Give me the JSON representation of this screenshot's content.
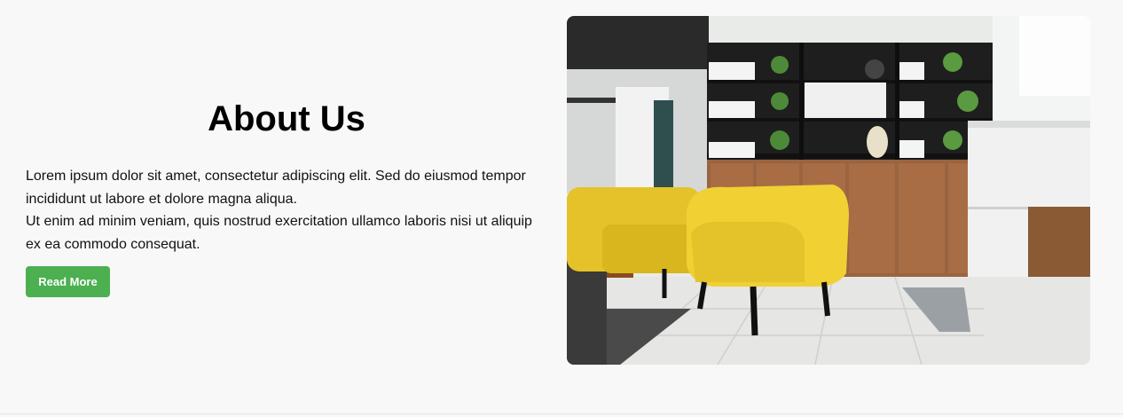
{
  "about": {
    "title": "About Us",
    "paragraph_line1": "Lorem ipsum dolor sit amet, consectetur adipiscing elit. Sed do eiusmod tempor incididunt ut labore et dolore magna aliqua.",
    "paragraph_line2": "Ut enim ad minim veniam, quis nostrud exercitation ullamco laboris nisi ut aliquip ex ea commodo consequat.",
    "button_label": "Read More",
    "button_color": "#4caf50"
  },
  "image": {
    "subject": "office-interior-yellow-armchairs"
  }
}
